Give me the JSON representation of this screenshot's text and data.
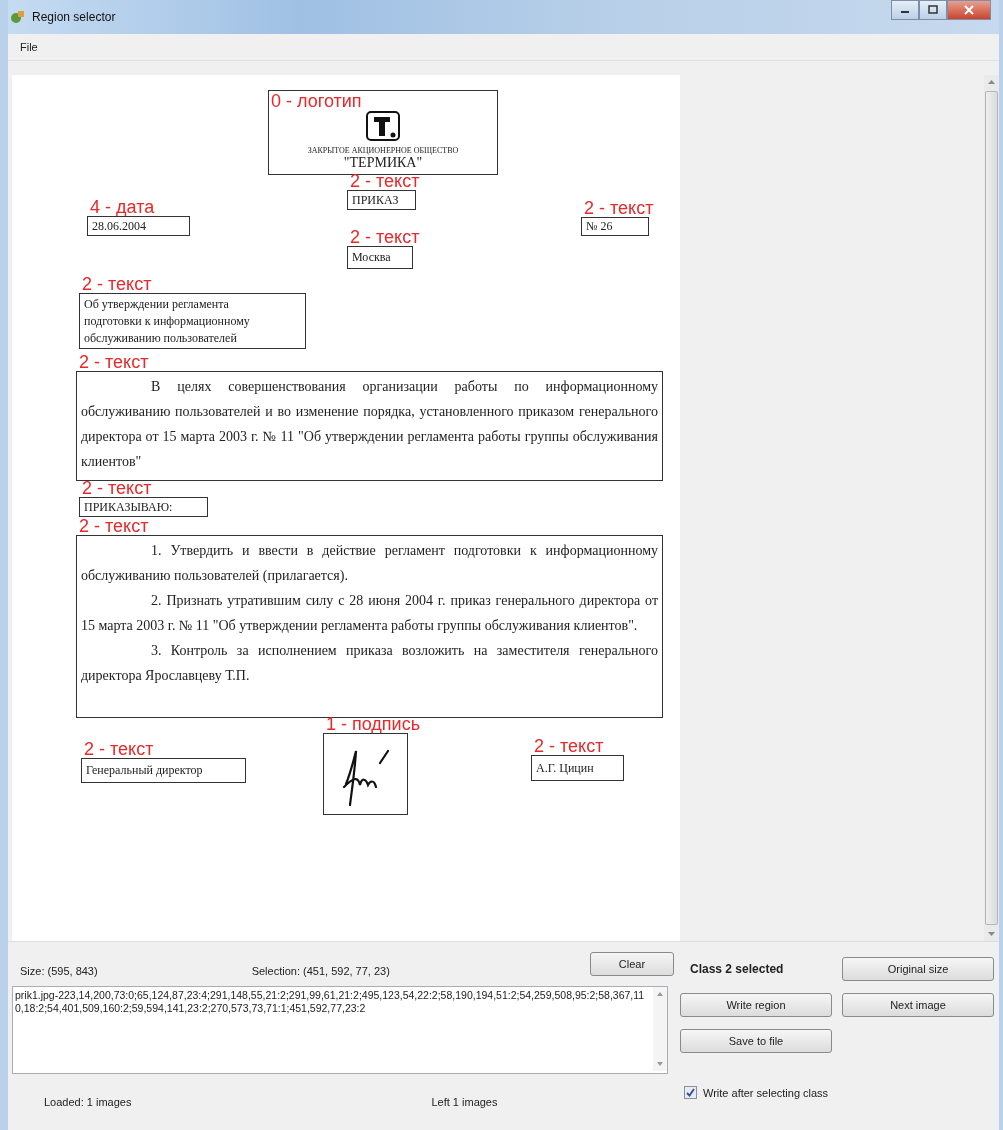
{
  "window": {
    "title": "Region selector"
  },
  "menu": [
    "File"
  ],
  "document": {
    "regions": [
      {
        "label": "0 - логотип",
        "kind": "logo",
        "lines": [
          "ЗАКРЫТОЕ АКЦИОНЕРНОЕ ОБЩЕСТВО",
          "\"ТЕРМИКА\""
        ]
      },
      {
        "label": "2 - текст",
        "kind": "text",
        "lines": [
          "ПРИКАЗ"
        ]
      },
      {
        "label": "4 - дата",
        "kind": "text",
        "lines": [
          "28.06.2004"
        ]
      },
      {
        "label": "2 - текст",
        "kind": "text",
        "lines": [
          "№ 26"
        ]
      },
      {
        "label": "2 - текст",
        "kind": "text",
        "lines": [
          "Москва"
        ]
      },
      {
        "label": "2 - текст",
        "kind": "text",
        "lines": [
          "Об утверждении регламента",
          "подготовки к информационному",
          "обслуживанию пользователей"
        ]
      },
      {
        "label": "2 - текст",
        "kind": "paragraphs",
        "lines": [
          "В целях совершенствования организации работы по информационному обслуживанию пользователей и во изменение порядка, установленного приказом генерального директора от 15 марта 2003 г. № 11 \"Об утверждении регламента работы группы обслуживания клиентов\""
        ]
      },
      {
        "label": "2 - текст",
        "kind": "text",
        "lines": [
          "ПРИКАЗЫВАЮ:"
        ]
      },
      {
        "label": "2 - текст",
        "kind": "paragraphs",
        "lines": [
          "1. Утвердить и ввести в действие регламент подготовки к информационному обслуживанию пользователей (прилагается).",
          "2. Признать утратившим силу с 28 июня 2004 г. приказ генерального директора от 15 марта 2003 г. № 11 \"Об утверждении регламента работы группы обслуживания клиентов\".",
          "3. Контроль за исполнением приказа возложить на заместителя генерального директора Ярославцеву Т.П."
        ]
      },
      {
        "label": "2 - текст",
        "kind": "text",
        "lines": [
          "Генеральный директор"
        ]
      },
      {
        "label": "1 - подпись",
        "kind": "signature"
      },
      {
        "label": "2 - текст",
        "kind": "text",
        "lines": [
          "А.Г. Цицин"
        ]
      }
    ]
  },
  "size": "Size: (595, 843)",
  "selection": "Selection: (451, 592, 77, 23)",
  "clear_button": "Clear",
  "class_status": "Class 2 selected",
  "region_list": "prik1.jpg-223,14,200,73:0;65,124,87,23:4;291,148,55,21:2;291,99,61,21:2;495,123,54,22:2;58,190,194,51:2;54,259,508,95:2;58,367,110,18:2;54,401,509,160:2;59,594,141,23:2;270,573,73,71:1;451,592,77,23:2",
  "buttons": [
    "Original size",
    "Write region",
    "Next image",
    "Save to file"
  ],
  "write_after_selecting": {
    "label": "Write after selecting class",
    "checked": true
  },
  "status_bar": {
    "loaded": "Loaded: 1 images",
    "left": "Left 1 images"
  }
}
